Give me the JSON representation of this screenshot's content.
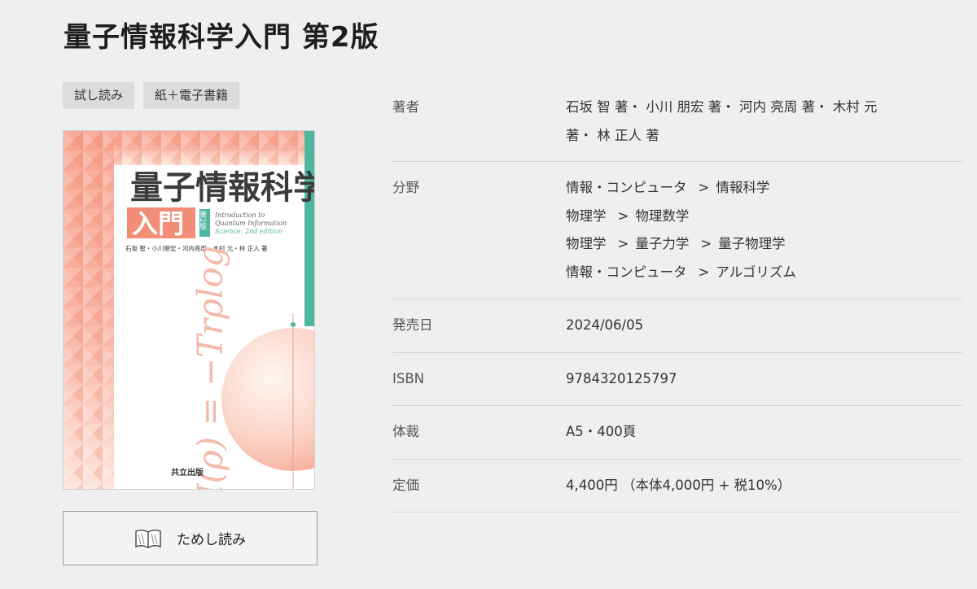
{
  "page": {
    "title": "量子情報科学入門 第2版"
  },
  "tags": [
    "試し読み",
    "紙＋電子書籍"
  ],
  "cover": {
    "title_main": "量子情報科学",
    "title_sub": "入門",
    "edition_badge": "第2版",
    "english_title_line1": "Introduction to",
    "english_title_line2": "Quantum Information",
    "english_title_line3": "Science: 2nd edition",
    "authors": "石坂 智・小川朋宏・河内亮周・木村 元・林 正人 著",
    "formula": "H(ρ) = −Trρlog",
    "publisher": "共立出版"
  },
  "trial_button": {
    "label": "ためし読み",
    "icon": "open-book-icon"
  },
  "details": {
    "author": {
      "label": "著者",
      "lines": [
        "石坂 智 著・ 小川 朋宏 著・ 河内 亮周 著・ 木村 元",
        "著・ 林 正人 著"
      ]
    },
    "category": {
      "label": "分野",
      "items": [
        {
          "parts": [
            "情報・コンピュータ",
            "情報科学"
          ]
        },
        {
          "parts": [
            "物理学",
            "物理数学"
          ]
        },
        {
          "parts": [
            "物理学",
            "量子力学",
            "量子物理学"
          ]
        },
        {
          "parts": [
            "情報・コンピュータ",
            "アルゴリズム"
          ]
        }
      ],
      "separator": ">"
    },
    "release_date": {
      "label": "発売日",
      "value": "2024/06/05"
    },
    "isbn": {
      "label": "ISBN",
      "value": "9784320125797"
    },
    "format": {
      "label": "体裁",
      "value": "A5・400頁"
    },
    "price": {
      "label": "定価",
      "value": "4,400円 （本体4,000円 + 税10%）"
    }
  },
  "colors": {
    "background": "#efefef",
    "cover_accent": "#f4a892",
    "cover_stripe": "#4fb7a0"
  }
}
